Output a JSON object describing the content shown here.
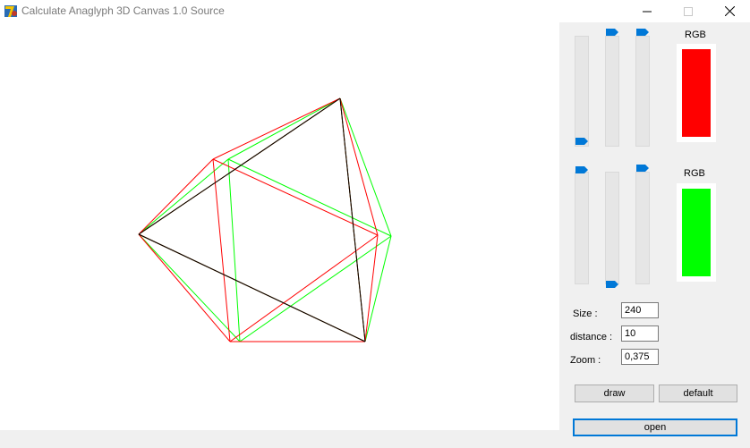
{
  "window": {
    "title": "Calculate Anaglyph 3D Canvas 1.0 Source",
    "icon": "delphi-app-icon",
    "controls": [
      "minimize-icon",
      "maximize-icon",
      "close-icon"
    ]
  },
  "canvas": {
    "left_color": "#ff0000",
    "right_color": "#00ff00",
    "overlap_color": "#000000"
  },
  "color1": {
    "label": "RGB",
    "swatch": "#ff0000",
    "slider_levels": [
      0.0,
      1.0,
      1.0
    ]
  },
  "color2": {
    "label": "RGB",
    "swatch": "#00ff00",
    "slider_levels": [
      1.0,
      0.0,
      1.0
    ]
  },
  "fields": {
    "size_label": "Size :",
    "size_value": "240",
    "distance_label": "distance :",
    "distance_value": "10",
    "zoom_label": "Zoom :",
    "zoom_value": "0,375"
  },
  "buttons": {
    "draw": "draw",
    "default": "default",
    "open": "open"
  },
  "accent": "#0078d7"
}
